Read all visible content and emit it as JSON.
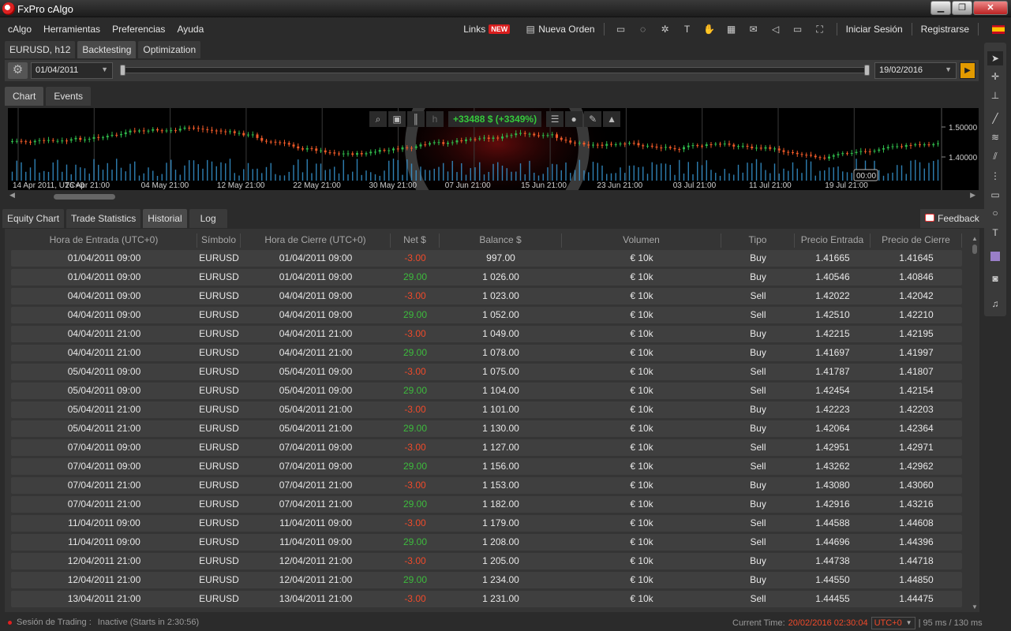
{
  "window": {
    "title": "FxPro cAlgo"
  },
  "menu": {
    "items": [
      "cAlgo",
      "Herramientas",
      "Preferencias",
      "Ayuda"
    ],
    "links_label": "Links",
    "new_badge": "NEW",
    "new_order_label": "Nueva Orden",
    "login_label": "Iniciar Sesión",
    "register_label": "Registrarse"
  },
  "top_tabs": [
    "EURUSD, h12",
    "Backtesting",
    "Optimization"
  ],
  "top_tabs_active": 1,
  "backtest": {
    "start_date": "01/04/2011",
    "end_date": "19/02/2016"
  },
  "chart_tabs": [
    "Chart",
    "Events"
  ],
  "chart": {
    "pnl_label": "+33488 $ (+3349%)",
    "price_levels": [
      "1.50000",
      "1.40000"
    ],
    "date_labels": [
      "14 Apr 2011, UTC+0",
      "26 Apr 21:00",
      "04 May 21:00",
      "12 May 21:00",
      "22 May 21:00",
      "30 May 21:00",
      "07 Jun 21:00",
      "15 Jun 21:00",
      "23 Jun 21:00",
      "03 Jul 21:00",
      "11 Jul 21:00",
      "19 Jul 21:00"
    ],
    "cursor_time": "00:00",
    "colors": {
      "bull": "#2fb84a",
      "bear": "#f05a28",
      "volume": "#3aa0e0"
    }
  },
  "bottom_tabs": [
    "Equity Chart",
    "Trade Statistics",
    "Historial",
    "Log"
  ],
  "bottom_tabs_active": 2,
  "feedback_label": "Feedback",
  "history": {
    "columns": [
      "Hora de Entrada (UTC+0)",
      "Símbolo",
      "Hora de Cierre (UTC+0)",
      "Net $",
      "Balance $",
      "Volumen",
      "Tipo",
      "Precio Entrada",
      "Precio de Cierre"
    ],
    "rows": [
      [
        "01/04/2011 09:00",
        "EURUSD",
        "01/04/2011 09:00",
        "-3.00",
        "997.00",
        "€ 10k",
        "Buy",
        "1.41665",
        "1.41645"
      ],
      [
        "01/04/2011 09:00",
        "EURUSD",
        "01/04/2011 09:00",
        "29.00",
        "1 026.00",
        "€ 10k",
        "Buy",
        "1.40546",
        "1.40846"
      ],
      [
        "04/04/2011 09:00",
        "EURUSD",
        "04/04/2011 09:00",
        "-3.00",
        "1 023.00",
        "€ 10k",
        "Sell",
        "1.42022",
        "1.42042"
      ],
      [
        "04/04/2011 09:00",
        "EURUSD",
        "04/04/2011 09:00",
        "29.00",
        "1 052.00",
        "€ 10k",
        "Sell",
        "1.42510",
        "1.42210"
      ],
      [
        "04/04/2011 21:00",
        "EURUSD",
        "04/04/2011 21:00",
        "-3.00",
        "1 049.00",
        "€ 10k",
        "Buy",
        "1.42215",
        "1.42195"
      ],
      [
        "04/04/2011 21:00",
        "EURUSD",
        "04/04/2011 21:00",
        "29.00",
        "1 078.00",
        "€ 10k",
        "Buy",
        "1.41697",
        "1.41997"
      ],
      [
        "05/04/2011 09:00",
        "EURUSD",
        "05/04/2011 09:00",
        "-3.00",
        "1 075.00",
        "€ 10k",
        "Sell",
        "1.41787",
        "1.41807"
      ],
      [
        "05/04/2011 09:00",
        "EURUSD",
        "05/04/2011 09:00",
        "29.00",
        "1 104.00",
        "€ 10k",
        "Sell",
        "1.42454",
        "1.42154"
      ],
      [
        "05/04/2011 21:00",
        "EURUSD",
        "05/04/2011 21:00",
        "-3.00",
        "1 101.00",
        "€ 10k",
        "Buy",
        "1.42223",
        "1.42203"
      ],
      [
        "05/04/2011 21:00",
        "EURUSD",
        "05/04/2011 21:00",
        "29.00",
        "1 130.00",
        "€ 10k",
        "Buy",
        "1.42064",
        "1.42364"
      ],
      [
        "07/04/2011 09:00",
        "EURUSD",
        "07/04/2011 09:00",
        "-3.00",
        "1 127.00",
        "€ 10k",
        "Sell",
        "1.42951",
        "1.42971"
      ],
      [
        "07/04/2011 09:00",
        "EURUSD",
        "07/04/2011 09:00",
        "29.00",
        "1 156.00",
        "€ 10k",
        "Sell",
        "1.43262",
        "1.42962"
      ],
      [
        "07/04/2011 21:00",
        "EURUSD",
        "07/04/2011 21:00",
        "-3.00",
        "1 153.00",
        "€ 10k",
        "Buy",
        "1.43080",
        "1.43060"
      ],
      [
        "07/04/2011 21:00",
        "EURUSD",
        "07/04/2011 21:00",
        "29.00",
        "1 182.00",
        "€ 10k",
        "Buy",
        "1.42916",
        "1.43216"
      ],
      [
        "11/04/2011 09:00",
        "EURUSD",
        "11/04/2011 09:00",
        "-3.00",
        "1 179.00",
        "€ 10k",
        "Sell",
        "1.44588",
        "1.44608"
      ],
      [
        "11/04/2011 09:00",
        "EURUSD",
        "11/04/2011 09:00",
        "29.00",
        "1 208.00",
        "€ 10k",
        "Sell",
        "1.44696",
        "1.44396"
      ],
      [
        "12/04/2011 21:00",
        "EURUSD",
        "12/04/2011 21:00",
        "-3.00",
        "1 205.00",
        "€ 10k",
        "Buy",
        "1.44738",
        "1.44718"
      ],
      [
        "12/04/2011 21:00",
        "EURUSD",
        "12/04/2011 21:00",
        "29.00",
        "1 234.00",
        "€ 10k",
        "Buy",
        "1.44550",
        "1.44850"
      ],
      [
        "13/04/2011 21:00",
        "EURUSD",
        "13/04/2011 21:00",
        "-3.00",
        "1 231.00",
        "€ 10k",
        "Sell",
        "1.44455",
        "1.44475"
      ]
    ]
  },
  "status": {
    "session_label": "Sesión de Trading :",
    "session_value": "Inactive (Starts in 2:30:56)",
    "current_time_label": "Current Time:",
    "current_time_value": "20/02/2016 02:30:04",
    "timezone": "UTC+0",
    "latency": "| 95 ms / 130 ms"
  }
}
